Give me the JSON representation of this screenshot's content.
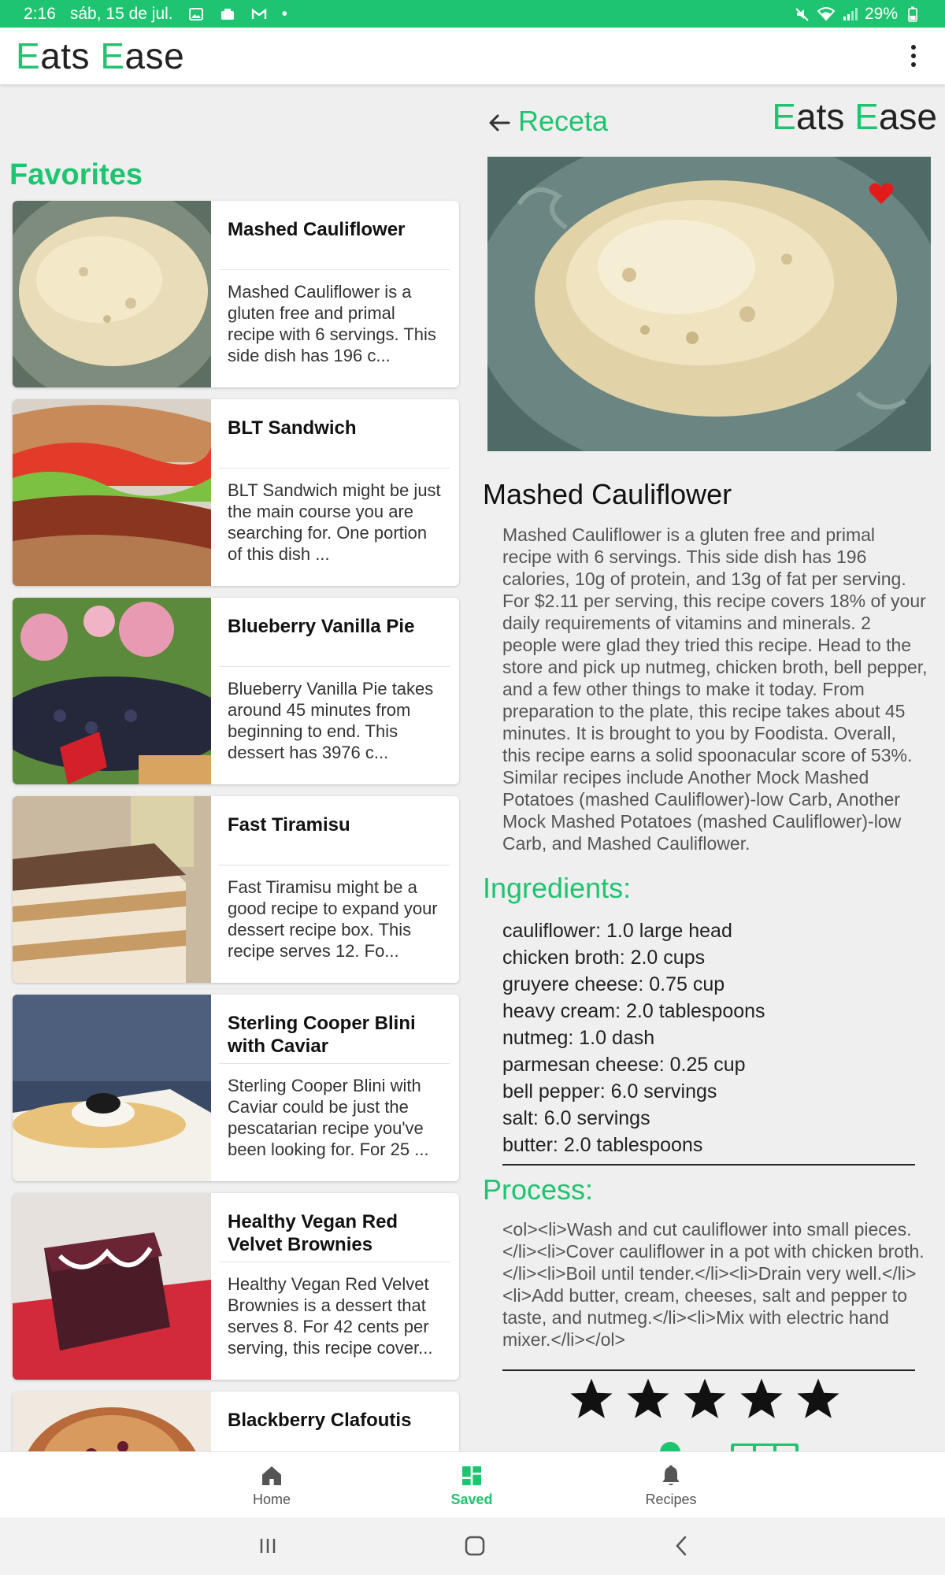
{
  "status_bar": {
    "time": "2:16",
    "date": "sáb, 15 de jul.",
    "dot": "•",
    "battery": "29%"
  },
  "app_bar": {
    "logo_first": "E",
    "logo_first_rest": "ats ",
    "logo_second": "E",
    "logo_second_rest": "ase"
  },
  "favorites": {
    "title": "Favorites",
    "items": [
      {
        "title": "Mashed Cauliflower",
        "desc": "Mashed Cauliflower is a gluten free and primal recipe with 6 servings. This side dish has 196 c..."
      },
      {
        "title": "BLT Sandwich",
        "desc": "BLT Sandwich might be just the main course you are searching for. One portion of this dish ..."
      },
      {
        "title": "Blueberry Vanilla Pie",
        "desc": "Blueberry Vanilla Pie takes around 45 minutes from beginning to end. This dessert has 3976 c..."
      },
      {
        "title": "Fast Tiramisu",
        "desc": "Fast Tiramisu might be a good recipe to expand your dessert recipe box. This recipe serves 12. Fo..."
      },
      {
        "title": "Sterling Cooper Blini with Caviar",
        "desc": "Sterling Cooper Blini with Caviar could be just the pescatarian recipe you've been looking for. For 25 ..."
      },
      {
        "title": "Healthy Vegan Red Velvet Brownies",
        "desc": "Healthy Vegan Red Velvet Brownies is a dessert that serves 8. For 42 cents per serving, this recipe cover..."
      },
      {
        "title": "Blackberry Clafoutis",
        "desc": ""
      }
    ]
  },
  "detail": {
    "header": "Receta",
    "title": "Mashed Cauliflower",
    "summary": "Mashed Cauliflower is a gluten free and primal recipe with 6 servings. This side dish has 196 calories, 10g of protein, and 13g of fat per serving. For $2.11 per serving, this recipe covers 18% of your daily requirements of vitamins and minerals. 2 people were glad they tried this recipe. Head to the store and pick up nutmeg, chicken broth, bell pepper, and a few other things to make it today. From preparation to the plate, this recipe takes about 45 minutes. It is brought to you by Foodista. Overall, this recipe earns a solid spoonacular score of 53%. Similar recipes include Another Mock Mashed Potatoes (mashed Cauliflower)-low Carb, Another Mock Mashed Potatoes (mashed Cauliflower)-low Carb, and Mashed Cauliflower.",
    "ingredients_title": "Ingredients:",
    "ingredients": [
      "cauliflower: 1.0 large head",
      "chicken broth: 2.0 cups",
      "gruyere cheese: 0.75 cup",
      "heavy cream: 2.0 tablespoons",
      "nutmeg: 1.0 dash",
      "parmesan cheese: 0.25 cup",
      "bell pepper: 6.0 servings",
      "salt: 6.0 servings",
      "butter: 2.0 tablespoons"
    ],
    "process_title": "Process:",
    "process": "<ol><li>Wash and cut cauliflower into small pieces.</li><li>Cover cauliflower in a pot with chicken broth.</li><li>Boil until tender.</li><li>Drain very well.</li><li>Add butter, cream, cheeses, salt and pepper to taste, and nutmeg.</li><li>Mix with electric hand mixer.</li></ol>",
    "rating": 5,
    "favorited": true
  },
  "bottom_nav": {
    "home": "Home",
    "saved": "Saved",
    "recipes": "Recipes"
  },
  "colors": {
    "accent": "#1ec46f",
    "heart": "#e31b1b"
  }
}
